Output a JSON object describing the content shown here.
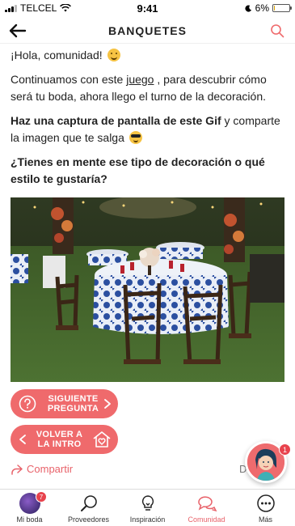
{
  "status_bar": {
    "carrier": "TELCEL",
    "time": "9:41",
    "battery": "6%",
    "battery_level": 0.06
  },
  "header": {
    "title": "BANQUETES"
  },
  "post": {
    "greeting": "¡Hola, comunidad!",
    "p2_before": "Continuamos con este ",
    "p2_link": "juego",
    "p2_after": " , para descubrir cómo será tu boda, ahora llego el turno de la decoración.",
    "p3_bold": "Haz una captura de pantalla de este Gif",
    "p3_after": " y comparte la imagen que te salga",
    "p4_bold": "¿Tienes en mente ese tipo de decoración o qué estilo te gustaría?"
  },
  "buttons": {
    "next_line1": "SIGUIENTE",
    "next_line2": "PREGUNTA",
    "intro_line1": "VOLVER A",
    "intro_line2": "LA INTRO"
  },
  "share": {
    "label": "Compartir",
    "partial_right": "D"
  },
  "assistant": {
    "badge": "1"
  },
  "tabbar": {
    "tabs": [
      {
        "label": "Mi boda",
        "badge": "7"
      },
      {
        "label": "Proveedores"
      },
      {
        "label": "Inspiración"
      },
      {
        "label": "Comunidad"
      },
      {
        "label": "Más"
      }
    ],
    "active_index": 3
  },
  "colors": {
    "accent": "#ef6a6c",
    "share_text": "#e8626a"
  }
}
